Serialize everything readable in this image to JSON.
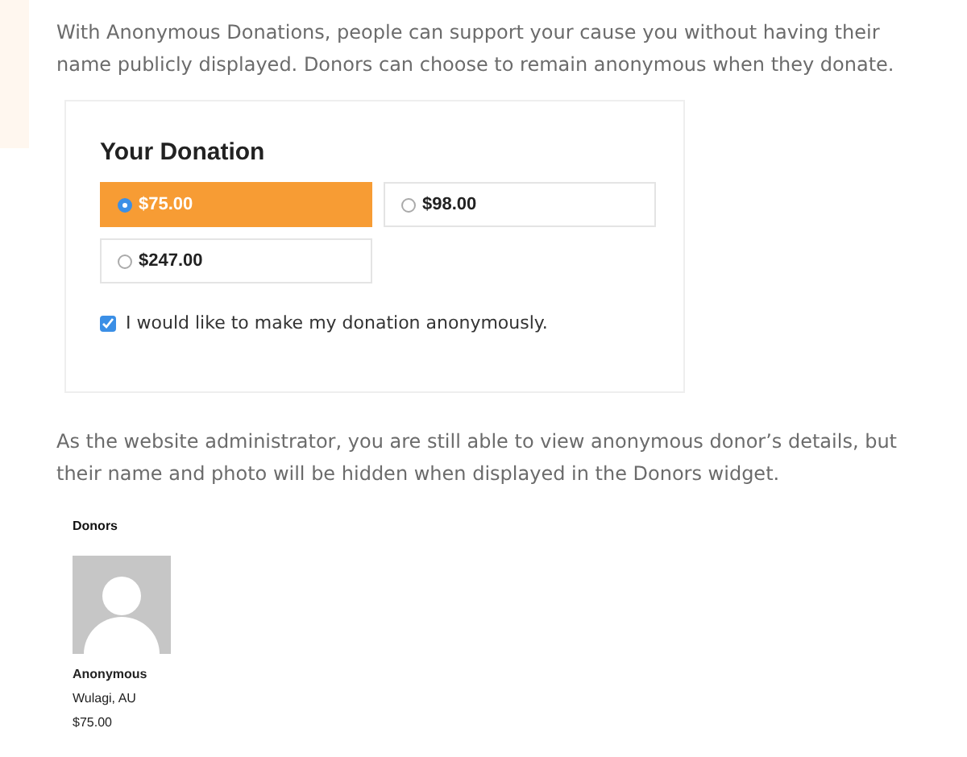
{
  "intro": "With Anonymous Donations, people can support your cause you without having their name publicly displayed. Donors can choose to remain anonymous when they donate.",
  "form": {
    "title": "Your Donation",
    "amounts": [
      {
        "label": "$75.00",
        "selected": true
      },
      {
        "label": "$98.00",
        "selected": false
      },
      {
        "label": "$247.00",
        "selected": false
      }
    ],
    "anonymous": {
      "label": "I would like to make my donation anonymously.",
      "checked": true
    }
  },
  "note": "As the website administrator, you are still able to view anonymous donor’s details, but their name and photo will be hidden when displayed in the Donors widget.",
  "widget": {
    "title": "Donors",
    "donors": [
      {
        "name": "Anonymous",
        "location": "Wulagi, AU",
        "amount": "$75.00"
      }
    ]
  }
}
